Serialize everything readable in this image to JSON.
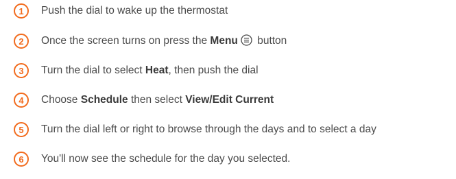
{
  "accent_color": "#f26b1d",
  "steps": [
    {
      "number": "1",
      "text": "Push the dial to wake up the thermostat"
    },
    {
      "number": "2",
      "text_before": "Once the screen turns on press the ",
      "bold": "Menu",
      "icon": "menu-list-icon",
      "text_after": " button"
    },
    {
      "number": "3",
      "text_before": "Turn the dial to select ",
      "bold": "Heat",
      "text_after": ", then push the dial"
    },
    {
      "number": "4",
      "text_before": "Choose ",
      "bold": "Schedule",
      "text_middle": " then select ",
      "bold2": "View/Edit Current"
    },
    {
      "number": "5",
      "text": "Turn the dial left or right to browse through the days and to select a day"
    },
    {
      "number": "6",
      "text": "You'll now see the schedule for the day you selected."
    }
  ]
}
